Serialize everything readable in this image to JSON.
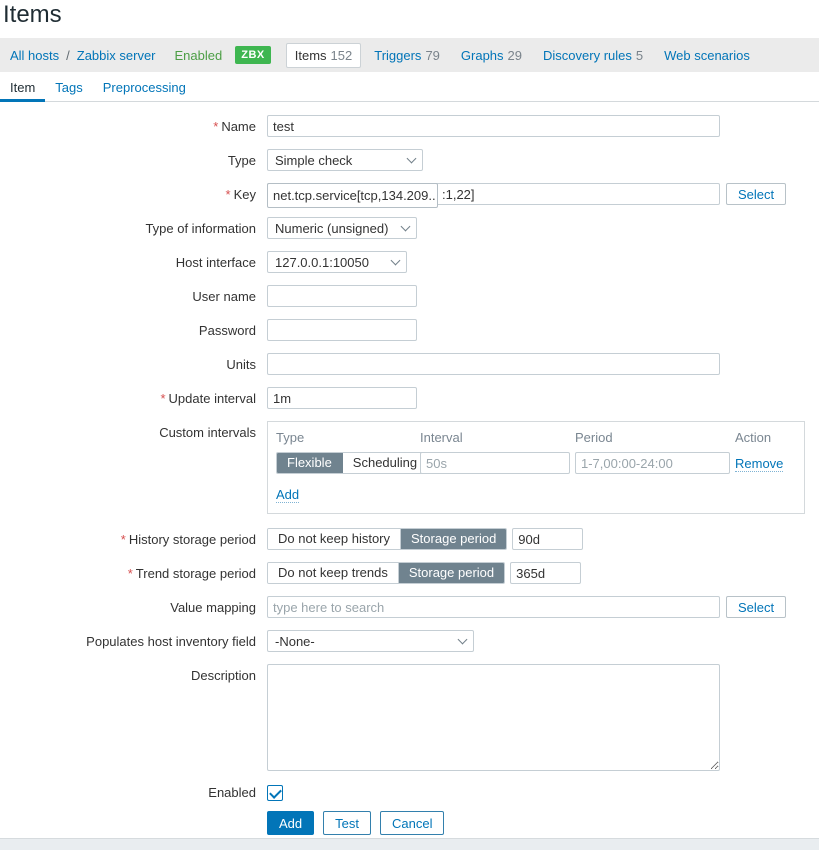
{
  "colors": {
    "link_blue": "#0275b8",
    "status_green_text": "#4c9e45",
    "badge_green": "#3eb650",
    "segment_active_gray": "#70838f",
    "required_red": "#d64e4e",
    "breadcrumb_bg": "#ebebeb"
  },
  "page": {
    "title": "Items"
  },
  "required_mark": "*",
  "breadcrumb": {
    "links": [
      {
        "label": "All hosts"
      },
      {
        "label": "Zabbix server"
      }
    ],
    "separator": "/",
    "status": "Enabled",
    "badge": "ZBX",
    "nav": [
      {
        "label": "Items",
        "count": "152",
        "active": true
      },
      {
        "label": "Triggers",
        "count": "79",
        "active": false
      },
      {
        "label": "Graphs",
        "count": "29",
        "active": false
      },
      {
        "label": "Discovery rules",
        "count": "5",
        "active": false
      },
      {
        "label": "Web scenarios",
        "count": "",
        "active": false
      }
    ]
  },
  "tabs": [
    {
      "label": "Item",
      "active": true
    },
    {
      "label": "Tags",
      "active": false
    },
    {
      "label": "Preprocessing",
      "active": false
    }
  ],
  "form": {
    "name": {
      "label": "Name",
      "value": "test"
    },
    "type": {
      "label": "Type",
      "value": "Simple check"
    },
    "key": {
      "label": "Key",
      "overlay_text": "net.tcp.service[tcp,134.209..",
      "visible_rest": ":1,22]",
      "select_button": "Select"
    },
    "type_of_information": {
      "label": "Type of information",
      "value": "Numeric (unsigned)"
    },
    "host_interface": {
      "label": "Host interface",
      "value": "127.0.0.1:10050"
    },
    "user_name": {
      "label": "User name",
      "value": ""
    },
    "password": {
      "label": "Password",
      "value": ""
    },
    "units": {
      "label": "Units",
      "value": ""
    },
    "update_interval": {
      "label": "Update interval",
      "value": "1m"
    },
    "custom_intervals": {
      "label": "Custom intervals",
      "columns": [
        "Type",
        "Interval",
        "Period",
        "Action"
      ],
      "row": {
        "type_options": [
          "Flexible",
          "Scheduling"
        ],
        "active_option": "Flexible",
        "interval_placeholder": "50s",
        "period_placeholder": "1-7,00:00-24:00",
        "action_label": "Remove"
      },
      "add_label": "Add"
    },
    "history": {
      "label": "History storage period",
      "options": [
        "Do not keep history",
        "Storage period"
      ],
      "active_option": "Storage period",
      "value": "90d"
    },
    "trends": {
      "label": "Trend storage period",
      "options": [
        "Do not keep trends",
        "Storage period"
      ],
      "active_option": "Storage period",
      "value": "365d"
    },
    "value_mapping": {
      "label": "Value mapping",
      "value": "",
      "placeholder": "type here to search",
      "select_button": "Select"
    },
    "inventory": {
      "label": "Populates host inventory field",
      "value": "-None-"
    },
    "description": {
      "label": "Description",
      "value": ""
    },
    "enabled": {
      "label": "Enabled",
      "checked": true
    }
  },
  "actions": {
    "add": "Add",
    "test": "Test",
    "cancel": "Cancel"
  }
}
